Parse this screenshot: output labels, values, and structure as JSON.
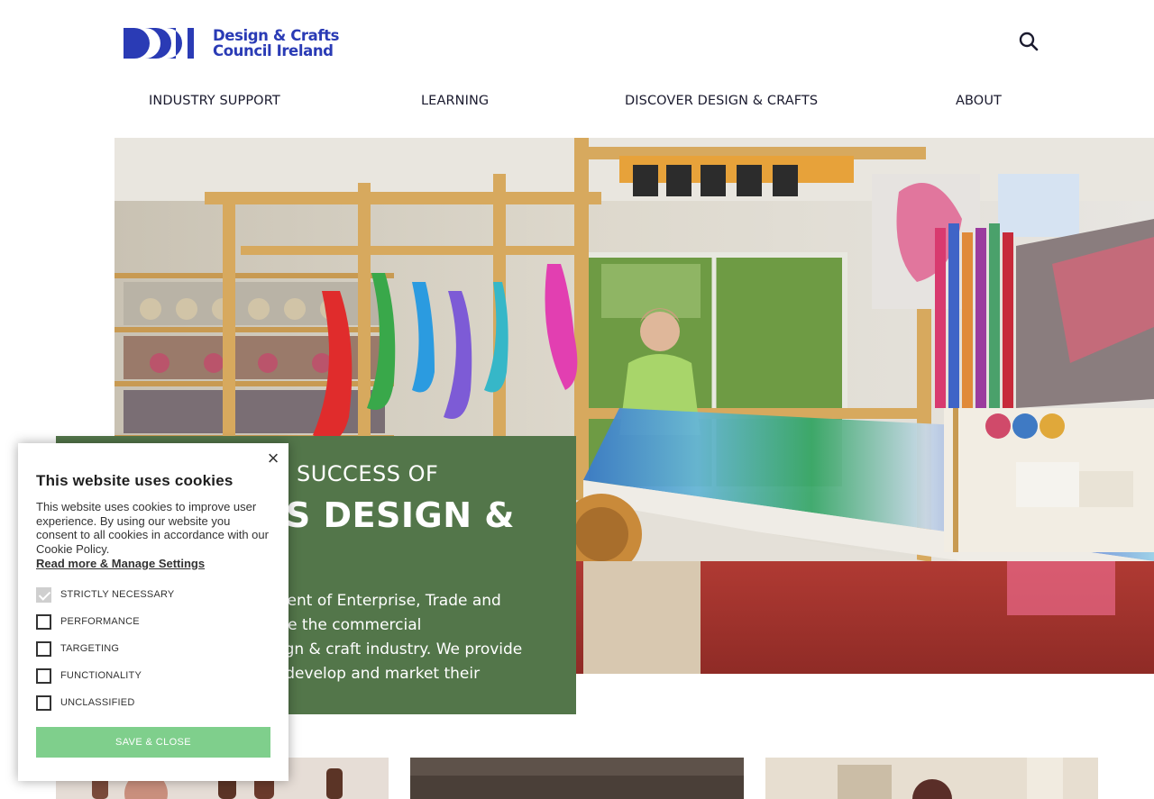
{
  "header": {
    "logo_text_line1": "Design & Crafts",
    "logo_text_line2": "Council Ireland",
    "search_icon": "search-icon"
  },
  "nav": {
    "items": [
      {
        "label": "INDUSTRY SUPPORT"
      },
      {
        "label": "LEARNING"
      },
      {
        "label": "DISCOVER DESIGN & CRAFTS"
      },
      {
        "label": "ABOUT"
      }
    ]
  },
  "hero": {
    "kicker": "SUCCESS OF",
    "title": "’S DESIGN &",
    "body_lines": [
      "ment of Enterprise, Trade and",
      "ote the commercial",
      "sign & craft industry. We provide",
      "s develop and market their"
    ]
  },
  "cookie": {
    "title": "This website uses cookies",
    "text": "This website uses cookies to improve user experience. By using our website you consent to all cookies in accordance with our Cookie Policy.",
    "link": "Read more & Manage Settings",
    "options": [
      {
        "label": "STRICTLY NECESSARY",
        "checked": true
      },
      {
        "label": "PERFORMANCE",
        "checked": false
      },
      {
        "label": "TARGETING",
        "checked": false
      },
      {
        "label": "FUNCTIONALITY",
        "checked": false
      },
      {
        "label": "UNCLASSIFIED",
        "checked": false
      }
    ],
    "save_label": "SAVE & CLOSE",
    "close_symbol": "×"
  },
  "colors": {
    "brand_blue": "#2a3bb5",
    "hero_green": "#53764a",
    "save_green": "#7fcf8c"
  }
}
